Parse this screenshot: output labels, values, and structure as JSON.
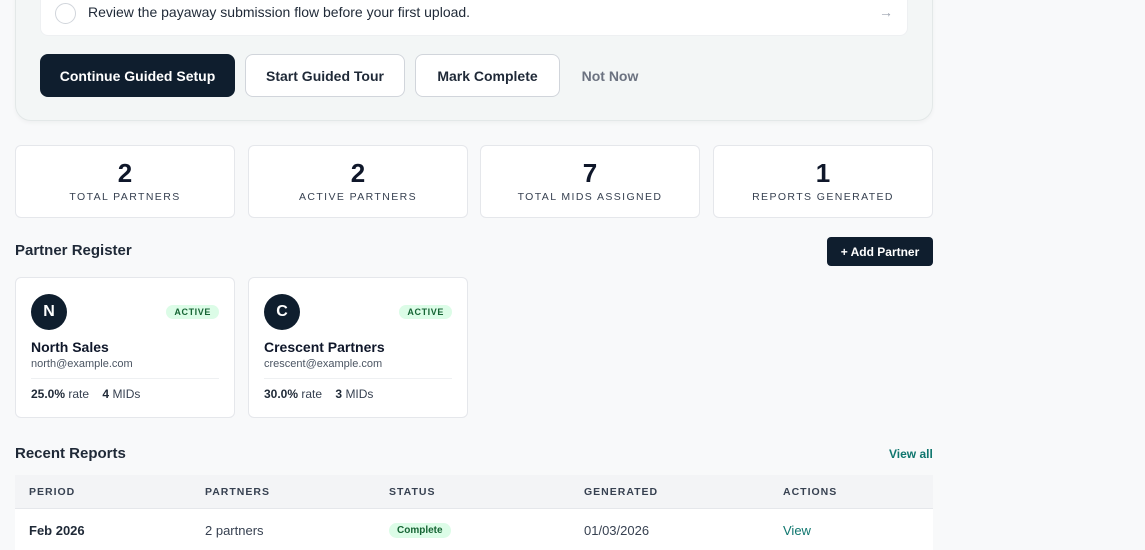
{
  "guide": {
    "task_text": "Review the payaway submission flow before your first upload.",
    "task_arrow": "→",
    "buttons": {
      "continue": "Continue Guided Setup",
      "tour": "Start Guided Tour",
      "mark": "Mark Complete",
      "not_now": "Not Now"
    }
  },
  "stats": [
    {
      "value": "2",
      "label": "TOTAL PARTNERS"
    },
    {
      "value": "2",
      "label": "ACTIVE PARTNERS"
    },
    {
      "value": "7",
      "label": "TOTAL MIDS ASSIGNED"
    },
    {
      "value": "1",
      "label": "REPORTS GENERATED"
    }
  ],
  "partner_register": {
    "title": "Partner Register",
    "add_button": "+ Add Partner",
    "partners": [
      {
        "initial": "N",
        "status": "ACTIVE",
        "name": "North Sales",
        "email": "north@example.com",
        "rate": "25.0%",
        "rate_label": "rate",
        "mids": "4",
        "mids_label": "MIDs"
      },
      {
        "initial": "C",
        "status": "ACTIVE",
        "name": "Crescent Partners",
        "email": "crescent@example.com",
        "rate": "30.0%",
        "rate_label": "rate",
        "mids": "3",
        "mids_label": "MIDs"
      }
    ]
  },
  "recent_reports": {
    "title": "Recent Reports",
    "view_all": "View all",
    "columns": [
      "PERIOD",
      "PARTNERS",
      "STATUS",
      "GENERATED",
      "ACTIONS"
    ],
    "rows": [
      {
        "period": "Feb 2026",
        "partners": "2 partners",
        "status": "Complete",
        "generated": "01/03/2026",
        "action": "View"
      }
    ]
  },
  "colors": {
    "brand_dark": "#0f1e2e",
    "accent_teal": "#0f766e",
    "success_bg": "#dcfce7",
    "success_text": "#166534"
  }
}
